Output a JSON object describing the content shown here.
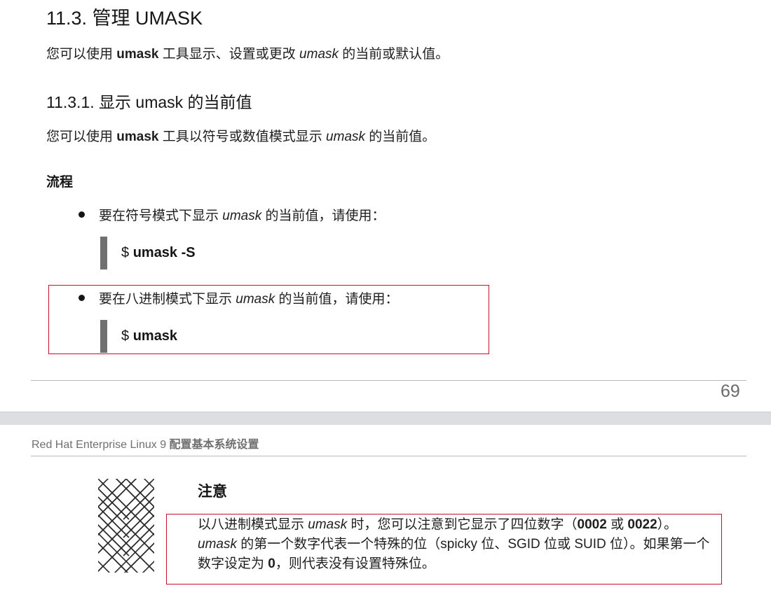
{
  "section": {
    "title": "11.3. 管理 UMASK",
    "intro": {
      "pre": "您可以使用 ",
      "cmd": "umask",
      "mid": " 工具显示、设置或更改 ",
      "term": "umask",
      "post": " 的当前或默认值。"
    }
  },
  "subsection": {
    "title_num": "11.3.1.",
    "title_text": " 显示 umask 的当前值",
    "para": {
      "pre": "您可以使用 ",
      "cmd": "umask",
      "mid": " 工具以符号或数值模式显示 ",
      "term": "umask",
      "post": " 的当前值。"
    }
  },
  "procedure": {
    "heading": "流程",
    "steps": [
      {
        "pre": "要在符号模式下显示 ",
        "term": "umask",
        "post": " 的当前值，请使用：",
        "prompt": "$ ",
        "command": "umask -S"
      },
      {
        "pre": "要在八进制模式下显示 ",
        "term": "umask",
        "post": " 的当前值，请使用：",
        "prompt": "$ ",
        "command": "umask"
      }
    ]
  },
  "page_number": "69",
  "running_header": {
    "product": "Red Hat Enterprise Linux 9 ",
    "doc": "配置基本系统设置"
  },
  "note": {
    "icon": "note-pattern-icon",
    "title": "注意",
    "t1": "以八进制模式显示 ",
    "t2": "umask",
    "t3": " 时，您可以注意到它显示了四位数字（",
    "t4": "0002",
    "t5": " 或 ",
    "t6": "0022",
    "t7": "）。",
    "t8": "umask",
    "t9": " 的第一个数字代表一个特殊的位（spicky 位、SGID 位或 SUID 位）。如果第一个数字设定为 ",
    "t10": "0",
    "t11": "，则代表没有设置特殊位。"
  },
  "colors": {
    "highlight_box": "#c8102e",
    "code_bar": "#707070"
  }
}
